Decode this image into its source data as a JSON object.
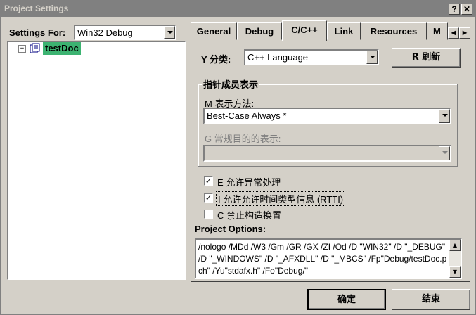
{
  "window": {
    "title": "Project Settings",
    "help_label": "?",
    "close_label": "✕"
  },
  "settings_for": {
    "label": "Settings For:",
    "value": "Win32 Debug"
  },
  "tree": {
    "expander": "+",
    "item_label": "testDoc"
  },
  "tabs": [
    {
      "label": "General"
    },
    {
      "label": "Debug"
    },
    {
      "label": "C/C++"
    },
    {
      "label": "Link"
    },
    {
      "label": "Resources"
    },
    {
      "label": "M"
    }
  ],
  "tab_scroll": {
    "left": "◀",
    "right": "▶"
  },
  "category": {
    "label": "Y 分类:",
    "value": "C++ Language"
  },
  "refresh_button": {
    "label": "R 刷新"
  },
  "pointer_group": {
    "title": "指针成员表示",
    "method_label": "M 表示方法:",
    "method_value": "Best-Case Always *",
    "general_label": "G 常规目的的表示:",
    "general_value": ""
  },
  "checkboxes": [
    {
      "label": "E 允许异常处理",
      "checked": true,
      "mark": "✓"
    },
    {
      "label": "I 允许允许时间类型信息 (RTTI)",
      "checked": true,
      "mark": "✓"
    },
    {
      "label": "C 禁止构造换置",
      "checked": false,
      "mark": ""
    }
  ],
  "project_options": {
    "label": "Project Options:",
    "text": "/nologo /MDd /W3 /Gm /GR /GX /ZI /Od /D \"WIN32\" /D \"_DEBUG\" /D \"_WINDOWS\" /D \"_AFXDLL\" /D \"_MBCS\" /Fp\"Debug/testDoc.pch\" /Yu\"stdafx.h\" /Fo\"Debug/\""
  },
  "ok_button": {
    "label": "确定"
  },
  "cancel_button": {
    "label": "结束"
  },
  "colors": {
    "titlebar": "#808080",
    "face": "#d4d0c8",
    "tree_highlight": "#3cb371"
  }
}
